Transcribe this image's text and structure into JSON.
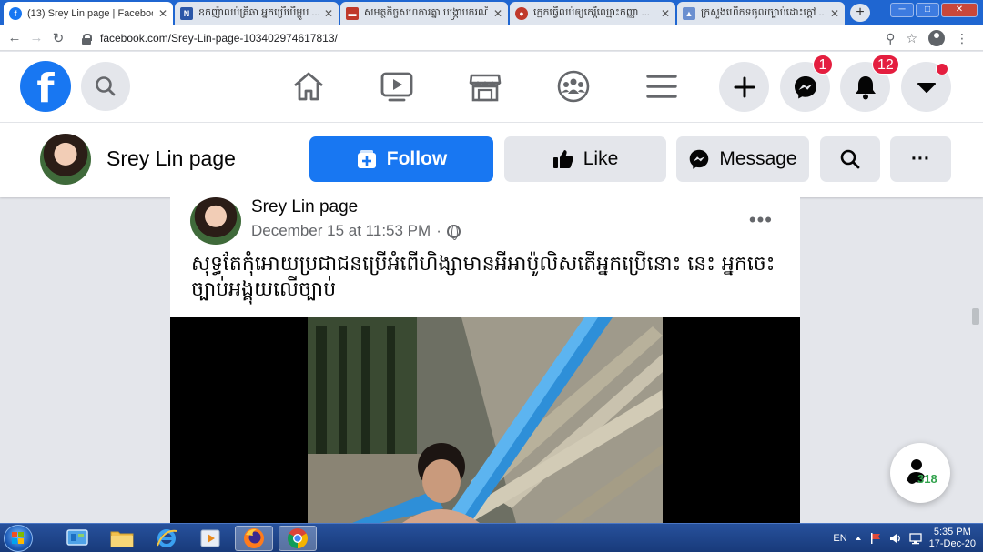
{
  "browser": {
    "tabs": [
      {
        "title": "(13) Srey Lin page | Facebook",
        "fav_color": "#1877f2",
        "fav_glyph": "f",
        "active": true
      },
      {
        "title": "ឧកញ៉ាលប់គ្រីឆា អ្នកប្រើបើម្ហូប ...",
        "fav_color": "#2b57a8",
        "fav_glyph": "N",
        "active": false
      },
      {
        "title": "សមត្ថកិច្ចសហការគ្នា បង្រ្កាបករណី ...",
        "fav_color": "#c0392b",
        "fav_glyph": "▬",
        "active": false
      },
      {
        "title": "ក្មេកធ្វើលប់ឲ្យកេរ្តិ៍ឈ្មោះកញ្ញា ...",
        "fav_color": "#c0392b",
        "fav_glyph": "●",
        "active": false
      },
      {
        "title": "ក្រសួងហើកទចូលច្បាប់ដោះក្ដៅ ...",
        "fav_color": "#6a8fd0",
        "fav_glyph": "▲",
        "active": false
      }
    ],
    "tab_close": "✕",
    "new_tab": "+",
    "window_buttons": {
      "minimize": "─",
      "maximize": "□",
      "close": "✕"
    },
    "url": "facebook.com/Srey-Lin-page-103402974617813/",
    "back_icon": "←",
    "forward_icon": "→",
    "reload_icon": "↻",
    "zoom_icon": "⚲",
    "star_icon": "☆",
    "menu_icon": "⋮"
  },
  "facebook": {
    "logo_letter": "f",
    "notifications": {
      "messenger_count": "1",
      "bell_count": "12"
    },
    "page": {
      "name": "Srey Lin page",
      "follow_label": "Follow",
      "like_label": "Like",
      "message_label": "Message",
      "more_label": "···"
    },
    "post": {
      "author": "Srey Lin page",
      "timestamp": "December 15 at 11:53 PM",
      "separator": "·",
      "more": "•••",
      "text": "សុទ្ធតែកុំអោយប្រជាជនប្រើអំពើហិង្សាមានអីអាប៉ូលិសតើអ្នកប្រើនោះ នេះ អ្នកចេះច្បាប់អង្គុយលើច្បាប់"
    },
    "contacts_count": "318"
  },
  "taskbar": {
    "language": "EN",
    "time": "5:35 PM",
    "date": "17-Dec-20"
  },
  "colors": {
    "fb_blue": "#1877f2",
    "badge_red": "#e41e3f",
    "taskbar_blue": "#1f4a94"
  }
}
